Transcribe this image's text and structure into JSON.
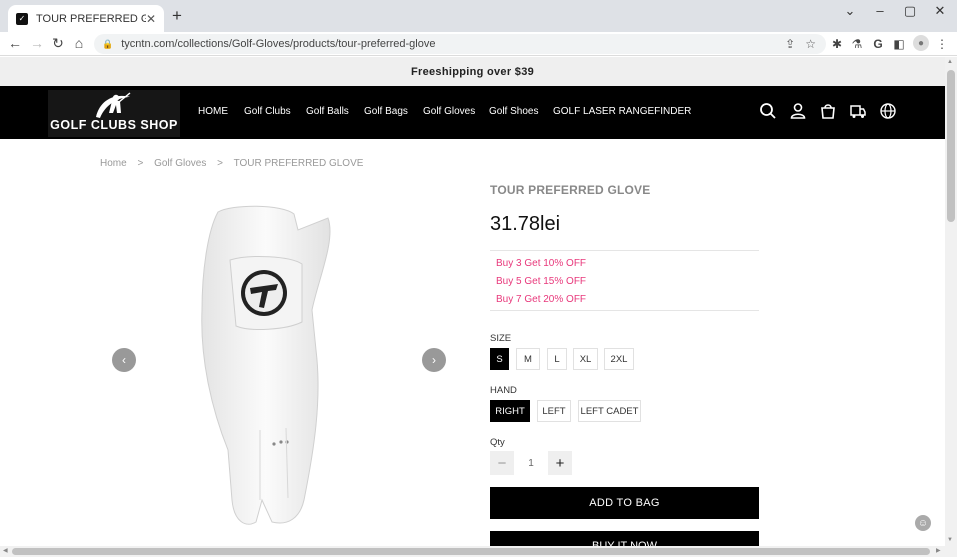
{
  "browser": {
    "tab_title": "TOUR PREFERRED GLOVE",
    "url": "tycntn.com/collections/Golf-Gloves/products/tour-preferred-glove"
  },
  "announcement": "Freeshipping over $39",
  "logo_text": "GOLF CLUBS SHOP",
  "nav": [
    "HOME",
    "Golf Clubs",
    "Golf Balls",
    "Golf Bags",
    "Golf Gloves",
    "Golf Shoes",
    "GOLF LASER RANGEFINDER"
  ],
  "header_icons": [
    "search-icon",
    "account-icon",
    "cart-icon",
    "shipping-icon",
    "globe-icon"
  ],
  "breadcrumb": [
    "Home",
    ">",
    "Golf Gloves",
    ">",
    "TOUR PREFERRED GLOVE"
  ],
  "product": {
    "title": "TOUR PREFERRED GLOVE",
    "price": "31.78lei",
    "promos": [
      "Buy 3 Get 10% OFF",
      "Buy 5 Get 15% OFF",
      "Buy 7 Get 20% OFF"
    ],
    "size_label": "SIZE",
    "sizes": [
      "S",
      "M",
      "L",
      "XL",
      "2XL"
    ],
    "size_selected": "S",
    "hand_label": "HAND",
    "hands": [
      "RIGHT",
      "LEFT",
      "LEFT CADET"
    ],
    "hand_selected": "RIGHT",
    "qty_label": "Qty",
    "qty": "1",
    "add_to_bag": "ADD TO BAG",
    "buy_now": "BUY IT NOW"
  },
  "colors": {
    "promo": "#e8387b",
    "header_bg": "#000000",
    "announce_bg": "#efefef"
  }
}
